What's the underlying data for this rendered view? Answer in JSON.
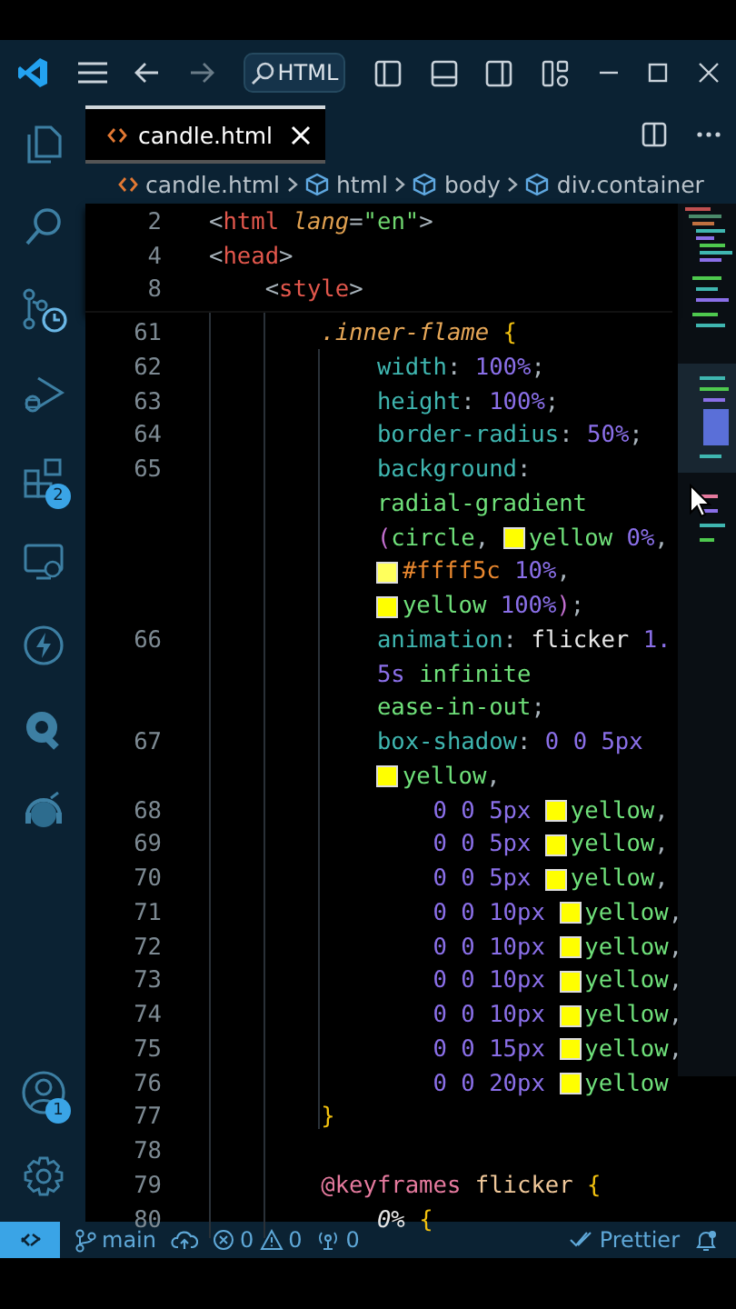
{
  "title_bar": {
    "search": "HTML"
  },
  "tab": {
    "label": "candle.html",
    "selected": true
  },
  "breadcrumbs": [
    {
      "kind": "file",
      "label": "candle.html"
    },
    {
      "kind": "element",
      "label": "html"
    },
    {
      "kind": "element",
      "label": "body"
    },
    {
      "kind": "element",
      "label": "div.container"
    }
  ],
  "activity_bar": [
    {
      "kind": "explorer"
    },
    {
      "kind": "search"
    },
    {
      "kind": "source-control"
    },
    {
      "kind": "run"
    },
    {
      "kind": "extensions",
      "badge": "2"
    },
    {
      "kind": "remote"
    },
    {
      "kind": "lightning"
    },
    {
      "kind": "q"
    },
    {
      "kind": "headset"
    }
  ],
  "activity_bar_bottom": [
    {
      "kind": "account",
      "badge": "1"
    },
    {
      "kind": "settings"
    }
  ],
  "sticky_lines": [
    {
      "number": "2",
      "kind": "document",
      "tokens": [
        {
          "kind": "punct",
          "text": "<"
        },
        {
          "kind": "tag",
          "text": "html"
        },
        {
          "kind": "attr",
          "text": " lang"
        },
        {
          "kind": "punct",
          "text": "="
        },
        {
          "kind": "string",
          "text": "\"en\""
        },
        {
          "kind": "punct",
          "text": ">"
        }
      ]
    },
    {
      "number": "4",
      "kind": "document",
      "tokens": [
        {
          "kind": "punct",
          "text": "<"
        },
        {
          "kind": "tag",
          "text": "head"
        },
        {
          "kind": "punct",
          "text": ">"
        }
      ]
    },
    {
      "number": "8",
      "kind": "head",
      "tokens": [
        {
          "kind": "punct",
          "text": "<"
        },
        {
          "kind": "tag",
          "text": "style"
        },
        {
          "kind": "punct",
          "text": ">"
        }
      ]
    }
  ],
  "code_lines": [
    {
      "number": "61",
      "kind": "stylesheet",
      "tokens": [
        {
          "kind": "selector",
          "text": ".inner-flame "
        },
        {
          "kind": "brace",
          "text": "{"
        }
      ]
    },
    {
      "number": "62",
      "kind": "rule",
      "tokens": [
        {
          "kind": "prop",
          "text": "width"
        },
        {
          "kind": "punct",
          "text": ": "
        },
        {
          "kind": "num",
          "text": "100%"
        },
        {
          "kind": "punct",
          "text": ";"
        }
      ]
    },
    {
      "number": "63",
      "kind": "rule",
      "tokens": [
        {
          "kind": "prop",
          "text": "height"
        },
        {
          "kind": "punct",
          "text": ": "
        },
        {
          "kind": "num",
          "text": "100%"
        },
        {
          "kind": "punct",
          "text": ";"
        }
      ]
    },
    {
      "number": "64",
      "kind": "rule",
      "tokens": [
        {
          "kind": "prop",
          "text": "border-radius"
        },
        {
          "kind": "punct",
          "text": ": "
        },
        {
          "kind": "num",
          "text": "50%"
        },
        {
          "kind": "punct",
          "text": ";"
        }
      ]
    },
    {
      "number": "65",
      "kind": "rule",
      "tokens": [
        {
          "kind": "prop",
          "text": "background"
        },
        {
          "kind": "punct",
          "text": ":"
        }
      ]
    },
    {
      "kind": "rule",
      "tokens": [
        {
          "kind": "value",
          "text": "radial-gradient"
        }
      ]
    },
    {
      "kind": "rule",
      "tokens": [
        {
          "kind": "paren",
          "text": "("
        },
        {
          "kind": "value",
          "text": "circle"
        },
        {
          "kind": "punct",
          "text": ", "
        },
        {
          "kind": "swatch",
          "color": "#ffff00"
        },
        {
          "kind": "value",
          "text": "yellow"
        },
        {
          "kind": "num",
          "text": " 0%"
        },
        {
          "kind": "punct",
          "text": ","
        }
      ]
    },
    {
      "kind": "rule",
      "tokens": [
        {
          "kind": "swatch",
          "color": "#ffff5c"
        },
        {
          "kind": "hex",
          "text": "#ffff5c"
        },
        {
          "kind": "num",
          "text": " 10%"
        },
        {
          "kind": "punct",
          "text": ","
        }
      ]
    },
    {
      "kind": "rule",
      "tokens": [
        {
          "kind": "swatch",
          "color": "#ffff00"
        },
        {
          "kind": "value",
          "text": "yellow"
        },
        {
          "kind": "num",
          "text": " 100%"
        },
        {
          "kind": "paren",
          "text": ")"
        },
        {
          "kind": "punct",
          "text": ";"
        }
      ]
    },
    {
      "number": "66",
      "kind": "rule",
      "tokens": [
        {
          "kind": "prop",
          "text": "animation"
        },
        {
          "kind": "punct",
          "text": ": "
        },
        {
          "kind": "plain",
          "text": "flicker"
        },
        {
          "kind": "num",
          "text": " 1."
        }
      ]
    },
    {
      "kind": "rule",
      "tokens": [
        {
          "kind": "num",
          "text": "5s"
        },
        {
          "kind": "value",
          "text": " infinite"
        }
      ]
    },
    {
      "kind": "rule",
      "tokens": [
        {
          "kind": "value",
          "text": "ease-in-out"
        },
        {
          "kind": "punct",
          "text": ";"
        }
      ]
    },
    {
      "number": "67",
      "kind": "rule",
      "tokens": [
        {
          "kind": "prop",
          "text": "box-shadow"
        },
        {
          "kind": "punct",
          "text": ": "
        },
        {
          "kind": "num",
          "text": "0 0 5px"
        }
      ]
    },
    {
      "kind": "rule",
      "tokens": [
        {
          "kind": "swatch",
          "color": "#ffff00"
        },
        {
          "kind": "value",
          "text": "yellow"
        },
        {
          "kind": "punct",
          "text": ","
        }
      ]
    },
    {
      "number": "68",
      "kind": "shadows",
      "tokens": [
        {
          "kind": "num",
          "text": "0 0 5px "
        },
        {
          "kind": "swatch",
          "color": "#ffff00"
        },
        {
          "kind": "value",
          "text": "yellow"
        },
        {
          "kind": "punct",
          "text": ","
        }
      ]
    },
    {
      "number": "69",
      "kind": "shadows",
      "tokens": [
        {
          "kind": "num",
          "text": "0 0 5px "
        },
        {
          "kind": "swatch",
          "color": "#ffff00"
        },
        {
          "kind": "value",
          "text": "yellow"
        },
        {
          "kind": "punct",
          "text": ","
        }
      ]
    },
    {
      "number": "70",
      "kind": "shadows",
      "tokens": [
        {
          "kind": "num",
          "text": "0 0 5px "
        },
        {
          "kind": "swatch",
          "color": "#ffff00"
        },
        {
          "kind": "value",
          "text": "yellow"
        },
        {
          "kind": "punct",
          "text": ","
        }
      ]
    },
    {
      "number": "71",
      "kind": "shadows",
      "tokens": [
        {
          "kind": "num",
          "text": "0 0 10px "
        },
        {
          "kind": "swatch",
          "color": "#ffff00"
        },
        {
          "kind": "value",
          "text": "yellow"
        },
        {
          "kind": "punct",
          "text": ","
        }
      ]
    },
    {
      "number": "72",
      "kind": "shadows",
      "tokens": [
        {
          "kind": "num",
          "text": "0 0 10px "
        },
        {
          "kind": "swatch",
          "color": "#ffff00"
        },
        {
          "kind": "value",
          "text": "yellow"
        },
        {
          "kind": "punct",
          "text": ","
        }
      ]
    },
    {
      "number": "73",
      "kind": "shadows",
      "tokens": [
        {
          "kind": "num",
          "text": "0 0 10px "
        },
        {
          "kind": "swatch",
          "color": "#ffff00"
        },
        {
          "kind": "value",
          "text": "yellow"
        },
        {
          "kind": "punct",
          "text": ","
        }
      ]
    },
    {
      "number": "74",
      "kind": "shadows",
      "tokens": [
        {
          "kind": "num",
          "text": "0 0 10px "
        },
        {
          "kind": "swatch",
          "color": "#ffff00"
        },
        {
          "kind": "value",
          "text": "yellow"
        },
        {
          "kind": "punct",
          "text": ","
        }
      ]
    },
    {
      "number": "75",
      "kind": "shadows",
      "tokens": [
        {
          "kind": "num",
          "text": "0 0 15px "
        },
        {
          "kind": "swatch",
          "color": "#ffff00"
        },
        {
          "kind": "value",
          "text": "yellow"
        },
        {
          "kind": "punct",
          "text": ","
        }
      ]
    },
    {
      "number": "76",
      "kind": "shadows",
      "tokens": [
        {
          "kind": "num",
          "text": "0 0 20px "
        },
        {
          "kind": "swatch",
          "color": "#ffff00"
        },
        {
          "kind": "value",
          "text": "yellow"
        }
      ]
    },
    {
      "number": "77",
      "kind": "stylesheet",
      "tokens": [
        {
          "kind": "brace",
          "text": "}"
        }
      ]
    },
    {
      "number": "78",
      "kind": "stylesheet"
    },
    {
      "number": "79",
      "kind": "stylesheet",
      "tokens": [
        {
          "kind": "at",
          "text": "@keyframes "
        },
        {
          "kind": "name",
          "text": "flicker "
        },
        {
          "kind": "brace",
          "text": "{"
        }
      ]
    },
    {
      "number": "80",
      "kind": "rule",
      "tokens": [
        {
          "kind": "pct",
          "text": "0% "
        },
        {
          "kind": "brace",
          "text": "{"
        }
      ]
    }
  ],
  "status_bar": {
    "branch": "main",
    "errors": "0",
    "warnings": "0",
    "ports": "0",
    "formatter": "Prettier"
  }
}
